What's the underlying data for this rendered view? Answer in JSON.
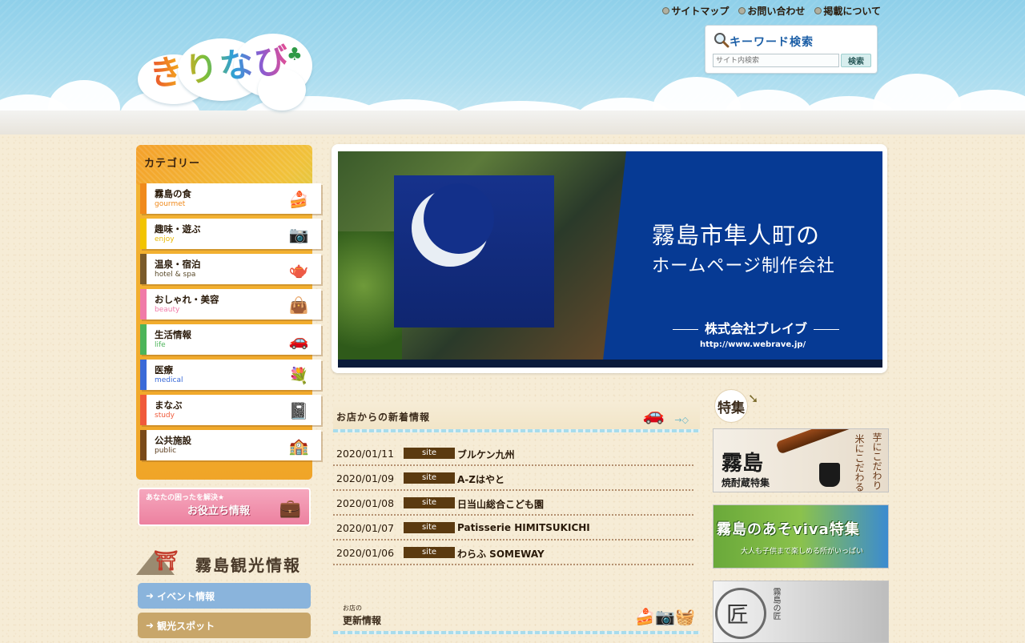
{
  "site": {
    "logo_text": "きりなび",
    "top_links": [
      "サイトマップ",
      "お問い合わせ",
      "掲載について"
    ],
    "search": {
      "title": "キーワード検索",
      "placeholder": "サイト内検索",
      "button": "検索"
    }
  },
  "sidebar": {
    "category_title": "カテゴリー",
    "categories": [
      {
        "ja": "霧島の食",
        "en": "gourmet",
        "color": "#f08a1c",
        "icon": "cake-icon"
      },
      {
        "ja": "趣味・遊ぶ",
        "en": "enjoy",
        "color": "#f2c400",
        "icon": "camera-icon"
      },
      {
        "ja": "温泉・宿泊",
        "en": "hotel & spa",
        "color": "#7a5a2a",
        "icon": "teapot-icon"
      },
      {
        "ja": "おしゃれ・美容",
        "en": "beauty",
        "color": "#f07aa8",
        "icon": "bag-icon"
      },
      {
        "ja": "生活情報",
        "en": "life",
        "color": "#4cb45a",
        "icon": "car-icon"
      },
      {
        "ja": "医療",
        "en": "medical",
        "color": "#3a6ad8",
        "icon": "flower-icon"
      },
      {
        "ja": "まなぶ",
        "en": "study",
        "color": "#f05a3a",
        "icon": "notebook-icon"
      },
      {
        "ja": "公共施設",
        "en": "public",
        "color": "#7a4a1a",
        "icon": "building-icon"
      }
    ],
    "help_banner": {
      "sub": "あなたの困ったを解決★",
      "main": "お役立ち情報"
    },
    "kanko_title": "霧島観光情報",
    "kanko_buttons": [
      {
        "label": "イベント情報",
        "color": "#8ab4dc"
      },
      {
        "label": "観光スポット",
        "color": "#c8a66a"
      }
    ]
  },
  "hero": {
    "line1": "霧島市隼人町の",
    "line2": "ホームページ制作会社",
    "company": "株式会社ブレイブ",
    "url": "http://www.webrave.jp/"
  },
  "news": {
    "title": "お店からの新着情報",
    "items": [
      {
        "date": "2020/01/11",
        "tag": "site",
        "shop": "ブルケン九州"
      },
      {
        "date": "2020/01/09",
        "tag": "site",
        "shop": "A-Zはやと"
      },
      {
        "date": "2020/01/08",
        "tag": "site",
        "shop": "日当山総合こども園"
      },
      {
        "date": "2020/01/07",
        "tag": "site",
        "shop": "Patisserie HIMITSUKICHI"
      },
      {
        "date": "2020/01/06",
        "tag": "site",
        "shop": "わらふ SOMEWAY"
      }
    ]
  },
  "updates": {
    "title_small": "お店の",
    "title": "更新情報"
  },
  "features": {
    "title": "特集",
    "banners": [
      {
        "main": "霧島",
        "sub": "焼酎蔵特集",
        "v1": "芋にこだわり",
        "v2": "米にこだわる"
      },
      {
        "main": "霧島のあそviva特集",
        "sub": "大人も子供まで楽しめる所がいっぱい"
      },
      {
        "main": "匠",
        "sub": "霧島の匠"
      }
    ]
  }
}
